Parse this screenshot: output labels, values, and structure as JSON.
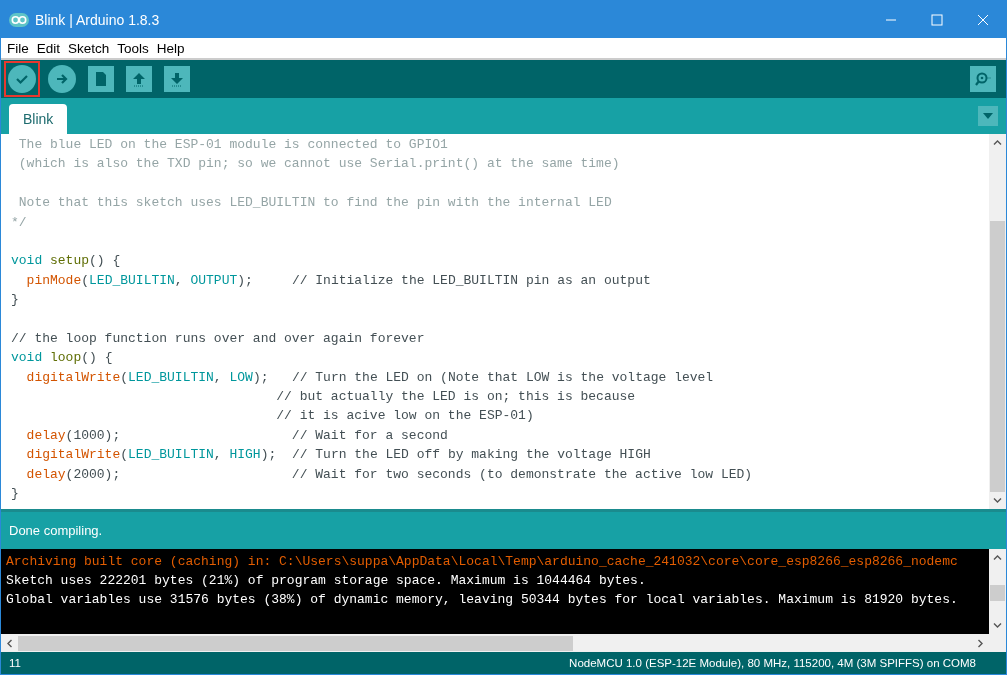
{
  "window": {
    "title": "Blink | Arduino 1.8.3"
  },
  "menu": [
    "File",
    "Edit",
    "Sketch",
    "Tools",
    "Help"
  ],
  "toolbar": [
    {
      "kind": "verify",
      "highlighted": true
    },
    {
      "kind": "upload",
      "highlighted": false
    },
    {
      "kind": "new",
      "highlighted": false
    },
    {
      "kind": "open",
      "highlighted": false
    },
    {
      "kind": "save",
      "highlighted": false
    }
  ],
  "tabs": [
    {
      "label": "Blink",
      "selected": true
    }
  ],
  "code_lines": [
    {
      "kind": "code",
      "segments": [
        {
          "kind": "comment",
          "text": " The blue LED on the ESP-01 module is connected to GPIO1"
        }
      ]
    },
    {
      "kind": "code",
      "segments": [
        {
          "kind": "comment",
          "text": " (which is also the TXD pin; so we cannot use Serial.print() at the same time)"
        }
      ]
    },
    {
      "kind": "blank"
    },
    {
      "kind": "code",
      "segments": [
        {
          "kind": "comment",
          "text": " Note that this sketch uses LED_BUILTIN to find the pin with the internal LED"
        }
      ]
    },
    {
      "kind": "code",
      "segments": [
        {
          "kind": "comment",
          "text": "*/"
        }
      ]
    },
    {
      "kind": "blank"
    },
    {
      "kind": "code",
      "segments": [
        {
          "kind": "type",
          "text": "void "
        },
        {
          "kind": "function",
          "text": "setup"
        },
        {
          "kind": "plain",
          "text": "() {"
        }
      ]
    },
    {
      "kind": "code",
      "segments": [
        {
          "kind": "call",
          "text": "  pinMode"
        },
        {
          "kind": "plain",
          "text": "("
        },
        {
          "kind": "constant",
          "text": "LED_BUILTIN"
        },
        {
          "kind": "plain",
          "text": ", "
        },
        {
          "kind": "constant",
          "text": "OUTPUT"
        },
        {
          "kind": "plain",
          "text": ");     // Initialize the LED_BUILTIN pin as an output"
        }
      ]
    },
    {
      "kind": "code",
      "segments": [
        {
          "kind": "plain",
          "text": "}"
        }
      ]
    },
    {
      "kind": "blank"
    },
    {
      "kind": "code",
      "segments": [
        {
          "kind": "plain",
          "text": "// the loop function runs over and over again forever"
        }
      ]
    },
    {
      "kind": "code",
      "segments": [
        {
          "kind": "type",
          "text": "void "
        },
        {
          "kind": "function",
          "text": "loop"
        },
        {
          "kind": "plain",
          "text": "() {"
        }
      ]
    },
    {
      "kind": "code",
      "segments": [
        {
          "kind": "call",
          "text": "  digitalWrite"
        },
        {
          "kind": "plain",
          "text": "("
        },
        {
          "kind": "constant",
          "text": "LED_BUILTIN"
        },
        {
          "kind": "plain",
          "text": ", "
        },
        {
          "kind": "constant",
          "text": "LOW"
        },
        {
          "kind": "plain",
          "text": ");   // Turn the LED on (Note that LOW is the voltage level"
        }
      ]
    },
    {
      "kind": "code",
      "segments": [
        {
          "kind": "plain",
          "text": "                                  // but actually the LED is on; this is because"
        }
      ]
    },
    {
      "kind": "code",
      "segments": [
        {
          "kind": "plain",
          "text": "                                  // it is acive low on the ESP-01)"
        }
      ]
    },
    {
      "kind": "code",
      "segments": [
        {
          "kind": "call",
          "text": "  delay"
        },
        {
          "kind": "plain",
          "text": "(1000);                      // Wait for a second"
        }
      ]
    },
    {
      "kind": "code",
      "segments": [
        {
          "kind": "call",
          "text": "  digitalWrite"
        },
        {
          "kind": "plain",
          "text": "("
        },
        {
          "kind": "constant",
          "text": "LED_BUILTIN"
        },
        {
          "kind": "plain",
          "text": ", "
        },
        {
          "kind": "constant",
          "text": "HIGH"
        },
        {
          "kind": "plain",
          "text": ");  // Turn the LED off by making the voltage HIGH"
        }
      ]
    },
    {
      "kind": "code",
      "segments": [
        {
          "kind": "call",
          "text": "  delay"
        },
        {
          "kind": "plain",
          "text": "(2000);                      // Wait for two seconds (to demonstrate the active low LED)"
        }
      ]
    },
    {
      "kind": "code",
      "segments": [
        {
          "kind": "plain",
          "text": "}"
        }
      ]
    }
  ],
  "status_message": "Done compiling.",
  "console_lines": [
    {
      "kind": "warning",
      "text": "Archiving built core (caching) in: C:\\Users\\suppa\\AppData\\Local\\Temp\\arduino_cache_241032\\core\\core_esp8266_esp8266_nodemc"
    },
    {
      "kind": "info",
      "text": "Sketch uses 222201 bytes (21%) of program storage space. Maximum is 1044464 bytes."
    },
    {
      "kind": "info",
      "text": "Global variables use 31576 bytes (38%) of dynamic memory, leaving 50344 bytes for local variables. Maximum is 81920 bytes."
    }
  ],
  "status_bar": {
    "line": "11",
    "board": "NodeMCU 1.0 (ESP-12E Module), 80 MHz, 115200, 4M (3M SPIFFS) on COM8"
  }
}
